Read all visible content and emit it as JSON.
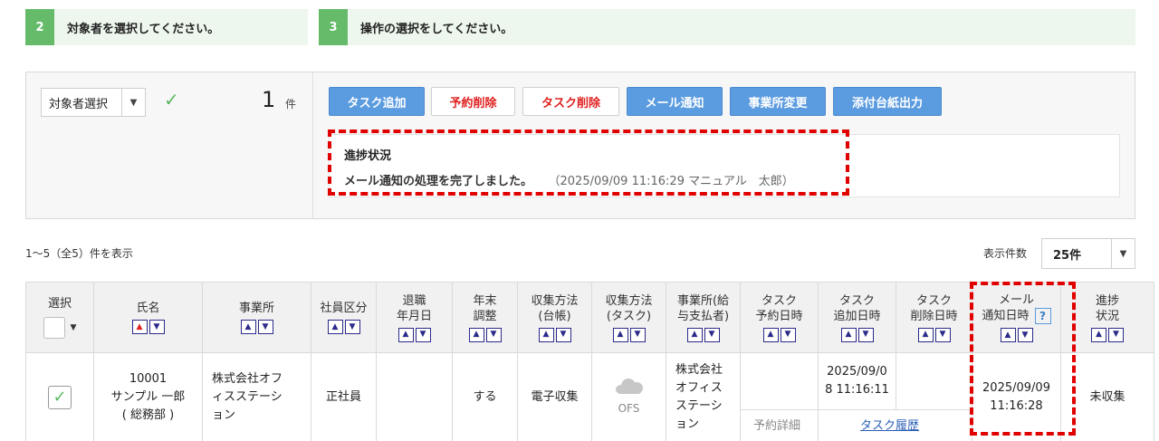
{
  "steps": [
    {
      "num": "2",
      "label": "対象者を選択してください。"
    },
    {
      "num": "3",
      "label": "操作の選択をしてください。"
    }
  ],
  "target": {
    "select_label": "対象者選択",
    "count": "1",
    "unit": "件"
  },
  "buttons": {
    "add_task": "タスク追加",
    "delete_reservation": "予約削除",
    "delete_task": "タスク削除",
    "mail_notify": "メール通知",
    "change_office": "事業所変更",
    "attachment_print": "添付台紙出力"
  },
  "status": {
    "title": "進捗状況",
    "message": "メール通知の処理を完了しました。",
    "timestamp": "（2025/09/09 11:16:29 マニュアル　太郎）"
  },
  "paging": {
    "range": "1〜5（全5）件を表示",
    "per_label": "表示件数",
    "per_value": "25件"
  },
  "table": {
    "headers": {
      "select": "選択",
      "name": "氏名",
      "office": "事業所",
      "emp_type": "社員区分",
      "retire_1": "退職",
      "retire_2": "年月日",
      "yearend_1": "年末",
      "yearend_2": "調整",
      "collect_ledger_1": "収集方法",
      "collect_ledger_2": "(台帳)",
      "collect_task_1": "収集方法",
      "collect_task_2": "(タスク)",
      "payer_1": "事業所(給",
      "payer_2": "与支払者)",
      "task_res_1": "タスク",
      "task_res_2": "予約日時",
      "task_add_1": "タスク",
      "task_add_2": "追加日時",
      "task_del_1": "タスク",
      "task_del_2": "削除日時",
      "mail_1": "メール",
      "mail_2": "通知日時",
      "progress_1": "進捗",
      "progress_2": "状況"
    },
    "row": {
      "id": "10001",
      "name": "サンプル 一郎",
      "dept": "( 総務部 )",
      "office_1": "株式会社オフ",
      "office_2": "ィスステーシ",
      "office_3": "ョン",
      "emp_type": "正社員",
      "yearend": "する",
      "collect_ledger": "電子収集",
      "collect_task": "OFS",
      "payer_1": "株式会社",
      "payer_2": "オフィス",
      "payer_3": "ステーシ",
      "payer_4": "ョン",
      "task_add_1": "2025/09/0",
      "task_add_2": "8 11:16:11",
      "reserve_detail": "予約詳細",
      "task_history": "タスク履歴",
      "mail_1": "2025/09/09",
      "mail_2": "11:16:28",
      "progress": "未収集"
    }
  },
  "icons": {
    "check": "check-icon",
    "help": "help-icon",
    "cloud": "cloud-icon",
    "caret": "caret-down-icon"
  },
  "colors": {
    "step_green": "#66bb6a",
    "primary_blue": "#5b9bdf",
    "danger_red": "#e02020",
    "highlight_red": "#e00000"
  }
}
